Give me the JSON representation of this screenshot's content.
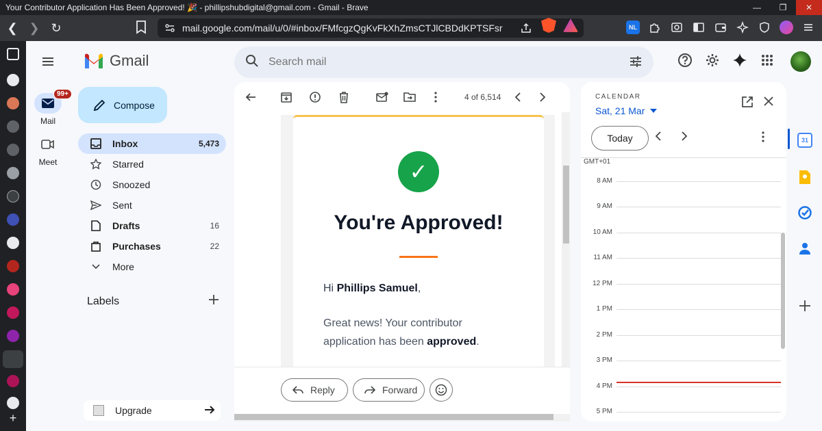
{
  "window": {
    "title": "Your Contributor Application Has Been Approved! 🎉 - phillipshubdigital@gmail.com - Gmail - Brave",
    "minimize": "—",
    "maximize": "❐",
    "close": "✕"
  },
  "browser": {
    "url": "mail.google.com/mail/u/0/#inbox/FMfcgzQgKvFkXhZmsCTJlCBDdKPTSFsr",
    "back": "❮",
    "forward": "❯",
    "reload": "↻"
  },
  "colors": {
    "accent": "#0b57d0",
    "active_pill": "#d3e3fd",
    "compose": "#c2e7ff",
    "success": "#16a34a",
    "orange": "#f97316",
    "now_line": "#d93025"
  },
  "rail": {
    "mail_label": "Mail",
    "mail_badge": "99+",
    "meet_label": "Meet"
  },
  "app": {
    "logo_text": "Gmail"
  },
  "compose": {
    "label": "Compose"
  },
  "nav": {
    "items": [
      {
        "label": "Inbox",
        "count": "5,473",
        "icon": "inbox-icon"
      },
      {
        "label": "Starred",
        "count": "",
        "icon": "star-icon"
      },
      {
        "label": "Snoozed",
        "count": "",
        "icon": "clock-icon"
      },
      {
        "label": "Sent",
        "count": "",
        "icon": "send-icon"
      },
      {
        "label": "Drafts",
        "count": "16",
        "icon": "draft-icon"
      },
      {
        "label": "Purchases",
        "count": "22",
        "icon": "bag-icon"
      },
      {
        "label": "More",
        "count": "",
        "icon": "chevron-down-icon"
      }
    ]
  },
  "labels": {
    "heading": "Labels",
    "add": "+"
  },
  "upgrade": {
    "label": "Upgrade"
  },
  "search": {
    "placeholder": "Search mail"
  },
  "email": {
    "pager": "4 of 6,514",
    "headline": "You're Approved!",
    "greeting_prefix": "Hi ",
    "greeting_name": "Phillips Samuel",
    "greeting_suffix": ",",
    "para_prefix": "Great news! Your contributor application has been ",
    "para_bold": "approved",
    "para_suffix": ".",
    "check_glyph": "✓"
  },
  "reply": {
    "reply_label": "Reply",
    "forward_label": "Forward"
  },
  "calendar": {
    "label": "CALENDAR",
    "date": "Sat, 21 Mar",
    "today": "Today",
    "timezone": "GMT+01",
    "hours": [
      "8 AM",
      "9 AM",
      "10 AM",
      "11 AM",
      "12 PM",
      "1 PM",
      "2 PM",
      "3 PM",
      "4 PM",
      "5 PM"
    ]
  }
}
